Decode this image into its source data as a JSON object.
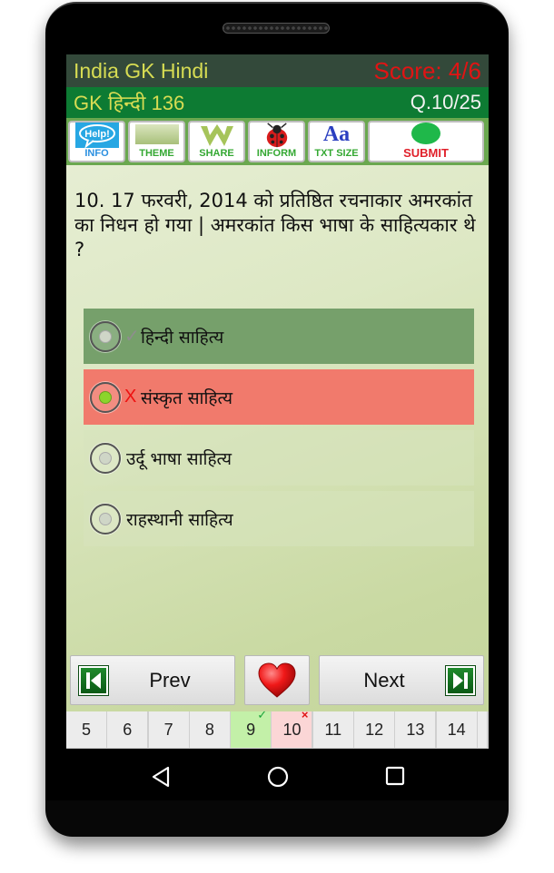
{
  "header": {
    "app_title": "India GK Hindi",
    "score": "Score: 4/6",
    "quiz_name": "GK हिन्दी 136",
    "question_counter": "Q.10/25"
  },
  "toolbar": {
    "items": [
      {
        "label": "INFO",
        "icon": "help-bubble-icon"
      },
      {
        "label": "THEME",
        "icon": "theme-swatch-icon"
      },
      {
        "label": "SHARE",
        "icon": "share-w-icon"
      },
      {
        "label": "INFORM",
        "icon": "ladybug-icon"
      },
      {
        "label": "TXT SIZE",
        "icon": "text-size-icon"
      },
      {
        "label": "SUBMIT",
        "icon": "green-circle-icon"
      }
    ],
    "help_text": "Help!",
    "txt_size_glyph": "Aa"
  },
  "question": {
    "text": "10. 17 फरवरी, 2014 को प्रतिष्ठित रचनाकार अमरकांत का निधन हो गया | अमरकांत किस भाषा के साहित्यकार थे ?"
  },
  "options": [
    {
      "text": "हिन्दी साहित्य",
      "state": "correct",
      "selected": false,
      "mark": "✓"
    },
    {
      "text": "संस्कृत साहित्य",
      "state": "wrong",
      "selected": true,
      "mark": "X"
    },
    {
      "text": "उर्दू भाषा साहित्य",
      "state": "plain",
      "selected": false,
      "mark": ""
    },
    {
      "text": "राहस्थानी साहित्य",
      "state": "plain",
      "selected": false,
      "mark": ""
    }
  ],
  "navigation": {
    "prev_label": "Prev",
    "next_label": "Next",
    "favorite_icon": "heart-icon"
  },
  "pager": {
    "items": [
      {
        "num": "5",
        "state": ""
      },
      {
        "num": "6",
        "state": ""
      },
      {
        "num": "7",
        "state": ""
      },
      {
        "num": "8",
        "state": ""
      },
      {
        "num": "9",
        "state": "right",
        "badge": "✓"
      },
      {
        "num": "10",
        "state": "wrong",
        "badge": "×"
      },
      {
        "num": "11",
        "state": ""
      },
      {
        "num": "12",
        "state": ""
      },
      {
        "num": "13",
        "state": ""
      },
      {
        "num": "14",
        "state": ""
      }
    ]
  },
  "colors": {
    "header_bg": "#33493a",
    "subheader_bg": "#0d7b33",
    "title_yellow": "#d7dc53",
    "score_red": "#e01414",
    "correct_bg": "#76a06b",
    "wrong_bg": "#f17a6c"
  }
}
